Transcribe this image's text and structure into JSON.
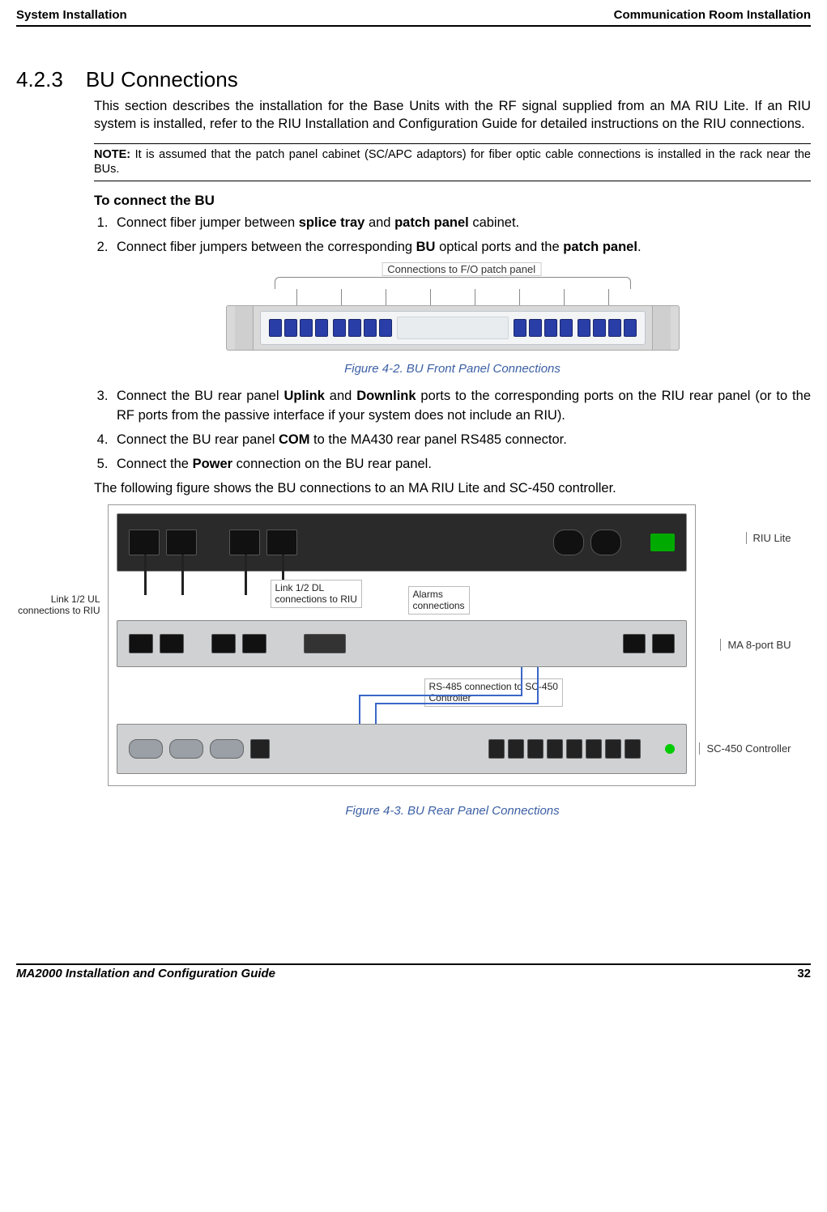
{
  "header": {
    "left": "System Installation",
    "right": "Communication Room Installation"
  },
  "section": {
    "number": "4.2.3",
    "title": "BU Connections"
  },
  "intro": "This section describes the installation for the Base Units with the RF signal supplied from an MA RIU Lite. If an RIU system is installed, refer to the RIU Installation and Configuration Guide for detailed instructions on the RIU connections.",
  "note_prefix": "NOTE:",
  "note_body": "It is assumed that the patch panel cabinet (SC/APC adaptors) for fiber optic cable connections is installed in the rack near the BUs.",
  "sub_heading": "To connect the BU",
  "steps": {
    "s1_pre": "Connect fiber jumper between ",
    "s1_b1": "splice tray",
    "s1_mid": " and ",
    "s1_b2": "patch panel",
    "s1_post": " cabinet.",
    "s2_pre": "Connect fiber jumpers between the corresponding ",
    "s2_b1": "BU",
    "s2_mid": " optical ports and the ",
    "s2_b2": "patch panel",
    "s2_post": ".",
    "s3_pre": "Connect the BU rear panel ",
    "s3_b1": "Uplink",
    "s3_mid1": " and ",
    "s3_b2": "Downlink",
    "s3_post": " ports to the corresponding ports on the RIU rear panel (or to the RF ports from the passive interface if your system does not include an RIU).",
    "s4_pre": "Connect the BU rear panel ",
    "s4_b1": "COM",
    "s4_post": " to the MA430 rear panel RS485 connector.",
    "s5_pre": "Connect the ",
    "s5_b1": "Power",
    "s5_post": " connection on the BU rear panel."
  },
  "figure1": {
    "callout": "Connections to F/O patch panel",
    "caption": "Figure 4-2. BU Front Panel Connections"
  },
  "post_steps_para": "The following figure shows the BU connections to an MA RIU Lite and SC-450 controller.",
  "figure2": {
    "caption": "Figure 4-3. BU Rear Panel Connections",
    "labels": {
      "riu": "RIU Lite",
      "bu": "MA 8-port BU",
      "sc": "SC-450 Controller",
      "left_ul": "Link 1/2 UL\nconnections to RIU",
      "c_dl": "Link 1/2 DL\nconnections to RIU",
      "c_alarms": "Alarms\nconnections",
      "c_rs485": "RS-485 connection to SC-450\nController"
    }
  },
  "footer": {
    "title": "MA2000 Installation and Configuration Guide",
    "page": "32"
  }
}
